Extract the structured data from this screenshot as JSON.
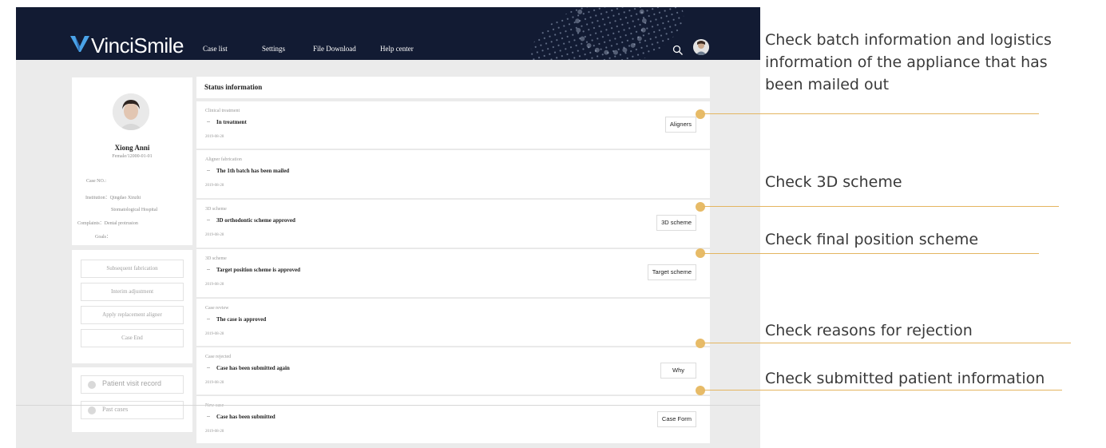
{
  "app": {
    "brand": "VinciSmile",
    "nav": [
      "Case list",
      "Settings",
      "File Download",
      "Help center"
    ]
  },
  "patient": {
    "name": "Xiong Anni",
    "sub": "Female/12000-01-01",
    "case_no": "Case NO.:",
    "institution_1": "Institution：Qingdao Xinzhi",
    "institution_2": "Stomatological Hospital",
    "complaints": "Complaints：Dental protrusion",
    "goals": "Goals："
  },
  "actions": [
    "Subsequent fabrication",
    "Interim adjustment",
    "Apply replacement aligner",
    "Case End"
  ],
  "records": [
    "Patient visit record",
    "Past cases"
  ],
  "status": {
    "title": "Status information",
    "items": [
      {
        "category": "Clinical treatment",
        "title": "In treatment",
        "date": "2019-08-28",
        "button": "Aligners"
      },
      {
        "category": "Aligner fabrication",
        "title": "The 1th batch has been mailed",
        "date": "2019-08-28",
        "button": ""
      },
      {
        "category": "3D scheme",
        "title": "3D orthodontic scheme approved",
        "date": "2019-08-28",
        "button": "3D scheme"
      },
      {
        "category": "3D scheme",
        "title": "Target position scheme is approved",
        "date": "2019-08-28",
        "button": "Target scheme"
      },
      {
        "category": "Case review",
        "title": "The case is approved",
        "date": "2019-08-28",
        "button": ""
      },
      {
        "category": "Case rejected",
        "title": "Case has been submitted again",
        "date": "2019-08-28",
        "button": "Why"
      },
      {
        "category": "New case",
        "title": "Case has been submitted",
        "date": "2019-08-28",
        "button": "Case Form"
      }
    ]
  },
  "callouts": [
    {
      "line1": "Check batch information and logistics",
      "line2": "information of the appliance that has",
      "line3": "been mailed out"
    },
    {
      "line1": "Check 3D scheme"
    },
    {
      "line1": "Check final position scheme"
    },
    {
      "line1": "Check reasons for rejection"
    },
    {
      "line1": "Check submitted patient information"
    }
  ],
  "colors": {
    "nav_bg": "#121b33",
    "brand_v": "#4aa3e8",
    "callout_gold": "#e4b560",
    "page_bg": "#ebebeb"
  },
  "icons": [
    "logo-v-icon",
    "search-icon",
    "user-avatar",
    "patient-photo",
    "radio-circle-icon"
  ]
}
